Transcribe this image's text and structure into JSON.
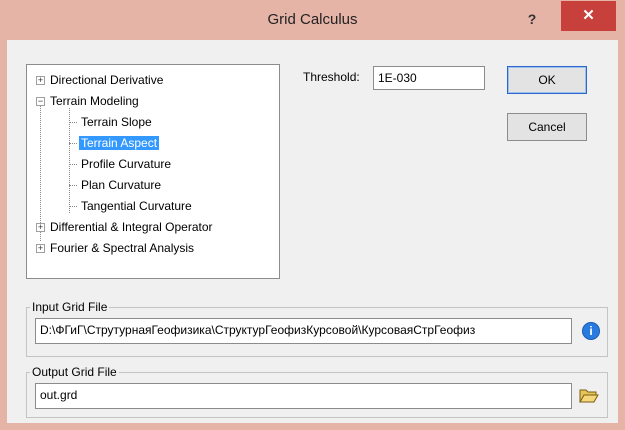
{
  "window": {
    "title": "Grid Calculus",
    "help_label": "?",
    "close_label": "✕"
  },
  "tree": {
    "items": [
      {
        "label": "Directional Derivative",
        "expander": "+"
      },
      {
        "label": "Terrain Modeling",
        "expander": "−"
      },
      {
        "label": "Terrain Slope"
      },
      {
        "label": "Terrain Aspect",
        "selected": true
      },
      {
        "label": "Profile Curvature"
      },
      {
        "label": "Plan Curvature"
      },
      {
        "label": "Tangential Curvature"
      },
      {
        "label": "Differential & Integral Operator",
        "expander": "+"
      },
      {
        "label": "Fourier & Spectral Analysis",
        "expander": "+"
      }
    ]
  },
  "threshold": {
    "label": "Threshold:",
    "value": "1E-030"
  },
  "buttons": {
    "ok": "OK",
    "cancel": "Cancel"
  },
  "input_grid": {
    "label": "Input Grid File",
    "value": "D:\\ФГиГ\\СтрутурнаяГеофизика\\СтруктурГеофизКурсовой\\КурсоваяСтрГеофиз",
    "icon": "info-icon"
  },
  "output_grid": {
    "label": "Output Grid File",
    "value": "out.grd",
    "icon": "open-folder-icon"
  },
  "colors": {
    "titlebar": "#e6b4a7",
    "close": "#c8403c",
    "selection": "#3399ff"
  }
}
